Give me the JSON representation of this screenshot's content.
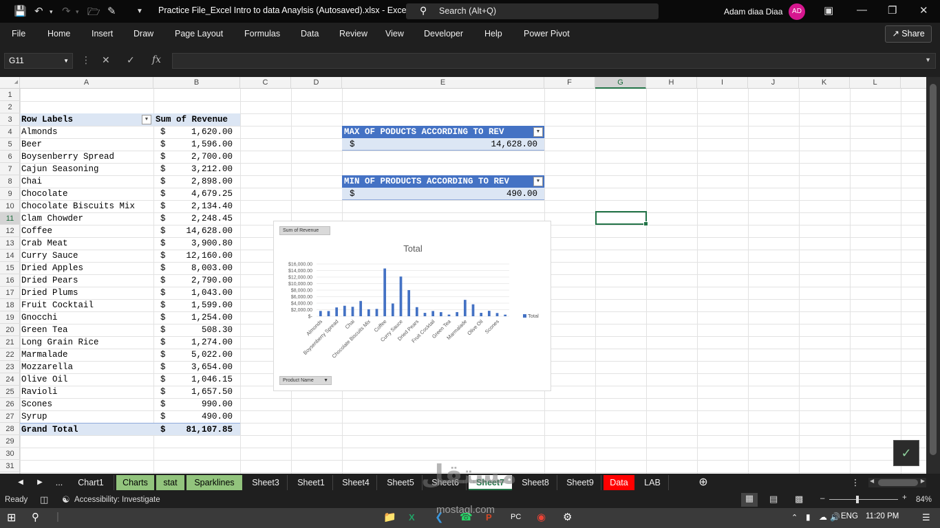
{
  "titlebar": {
    "doc_title": "Practice File_Excel Intro to data Anaylsis (Autosaved).xlsx  -  Excel",
    "search_placeholder": "Search (Alt+Q)",
    "user_name": "Adam diaa Diaa",
    "avatar_initials": "AD"
  },
  "ribbon": {
    "tabs": [
      "File",
      "Home",
      "Insert",
      "Draw",
      "Page Layout",
      "Formulas",
      "Data",
      "Review",
      "View",
      "Developer",
      "Help",
      "Power Pivot"
    ],
    "share_label": "Share"
  },
  "formula_bar": {
    "name_box": "G11",
    "formula": "",
    "fx_label": "fx"
  },
  "columns": [
    "A",
    "B",
    "C",
    "D",
    "E",
    "F",
    "G",
    "H",
    "I",
    "J",
    "K",
    "L"
  ],
  "rows": [
    "1",
    "2",
    "3",
    "4",
    "5",
    "6",
    "7",
    "8",
    "9",
    "10",
    "11",
    "12",
    "13",
    "14",
    "15",
    "16",
    "17",
    "18",
    "19",
    "20",
    "21",
    "22",
    "23",
    "24",
    "25",
    "26",
    "27",
    "28",
    "29",
    "30",
    "31"
  ],
  "pivot": {
    "header_label": "Row Labels",
    "header_value": "Sum of Revenue",
    "currency": "$",
    "items": [
      {
        "label": "Almonds",
        "value": "1,620.00"
      },
      {
        "label": "Beer",
        "value": "1,596.00"
      },
      {
        "label": "Boysenberry Spread",
        "value": "2,700.00"
      },
      {
        "label": "Cajun Seasoning",
        "value": "3,212.00"
      },
      {
        "label": "Chai",
        "value": "2,898.00"
      },
      {
        "label": "Chocolate",
        "value": "4,679.25"
      },
      {
        "label": "Chocolate Biscuits Mix",
        "value": "2,134.40"
      },
      {
        "label": "Clam Chowder",
        "value": "2,248.45"
      },
      {
        "label": "Coffee",
        "value": "14,628.00"
      },
      {
        "label": "Crab Meat",
        "value": "3,900.80"
      },
      {
        "label": "Curry Sauce",
        "value": "12,160.00"
      },
      {
        "label": "Dried Apples",
        "value": "8,003.00"
      },
      {
        "label": "Dried Pears",
        "value": "2,790.00"
      },
      {
        "label": "Dried Plums",
        "value": "1,043.00"
      },
      {
        "label": "Fruit Cocktail",
        "value": "1,599.00"
      },
      {
        "label": "Gnocchi",
        "value": "1,254.00"
      },
      {
        "label": "Green Tea",
        "value": "508.30"
      },
      {
        "label": "Long Grain Rice",
        "value": "1,274.00"
      },
      {
        "label": "Marmalade",
        "value": "5,022.00"
      },
      {
        "label": "Mozzarella",
        "value": "3,654.00"
      },
      {
        "label": "Olive Oil",
        "value": "1,046.15"
      },
      {
        "label": "Ravioli",
        "value": "1,657.50"
      },
      {
        "label": "Scones",
        "value": "990.00"
      },
      {
        "label": "Syrup",
        "value": "490.00"
      }
    ],
    "total_label": "Grand Total",
    "total_value": "81,107.85"
  },
  "max_pivot": {
    "header": "MAX OF PODUCTS ACCORDING TO REV",
    "currency": "$",
    "value": "14,628.00"
  },
  "min_pivot": {
    "header": "MIN OF PRODUCTS ACCORDING TO REV",
    "currency": "$",
    "value": "490.00"
  },
  "chart_data": {
    "type": "bar",
    "title": "Total",
    "value_field_button": "Sum of Revenue",
    "axis_field_button": "Product Name",
    "legend": "Total",
    "legend_position": "right",
    "categories": [
      "Almonds",
      "Beer",
      "Boysenberry Spread",
      "Cajun Seasoning",
      "Chai",
      "Chocolate",
      "Chocolate Biscuits Mix",
      "Clam Chowder",
      "Coffee",
      "Crab Meat",
      "Curry Sauce",
      "Dried Apples",
      "Dried Pears",
      "Dried Plums",
      "Fruit Cocktail",
      "Gnocchi",
      "Green Tea",
      "Long Grain Rice",
      "Marmalade",
      "Mozzarella",
      "Olive Oil",
      "Ravioli",
      "Scones",
      "Syrup"
    ],
    "shown_category_labels": [
      "Almonds",
      "Boysenberry Spread",
      "Chai",
      "Chocolate Biscuits Mix",
      "Coffee",
      "Curry Sauce",
      "Dried Pears",
      "Fruit Cocktail",
      "Green Tea",
      "Marmalade",
      "Olive Oil",
      "Scones"
    ],
    "values": [
      1620,
      1596,
      2700,
      3212,
      2898,
      4679.25,
      2134.4,
      2248.45,
      14628,
      3900.8,
      12160,
      8003,
      2790,
      1043,
      1599,
      1254,
      508.3,
      1274,
      5022,
      3654,
      1046.15,
      1657.5,
      990,
      490
    ],
    "yticks": [
      "$-",
      "$2,000.00",
      "$4,000.00",
      "$6,000.00",
      "$8,000.00",
      "$10,000.00",
      "$12,000.00",
      "$14,000.00",
      "$16,000.00"
    ],
    "ylim": [
      0,
      16000
    ],
    "grid": true,
    "bar_color": "#4472c4"
  },
  "sheet_tabs": [
    {
      "name": "Chart1",
      "style": "plain"
    },
    {
      "name": "Charts",
      "style": "green"
    },
    {
      "name": "stat",
      "style": "green"
    },
    {
      "name": "Sparklines",
      "style": "green"
    },
    {
      "name": "Sheet3",
      "style": "plain"
    },
    {
      "name": "Sheet1",
      "style": "plain"
    },
    {
      "name": "Sheet4",
      "style": "plain"
    },
    {
      "name": "Sheet5",
      "style": "plain"
    },
    {
      "name": "Sheet6",
      "style": "plain"
    },
    {
      "name": "Sheet7",
      "style": "active"
    },
    {
      "name": "Sheet8",
      "style": "plain"
    },
    {
      "name": "Sheet9",
      "style": "plain"
    },
    {
      "name": "Data",
      "style": "red"
    },
    {
      "name": "LAB",
      "style": "plain"
    }
  ],
  "tabs_ellipsis": "...",
  "status": {
    "ready": "Ready",
    "accessibility": "Accessibility: Investigate",
    "zoom": "84%"
  },
  "taskbar": {
    "lang": "ENG",
    "time": "11:20 PM"
  },
  "watermark": "مستقل",
  "watermark_url": "mostaql.com"
}
